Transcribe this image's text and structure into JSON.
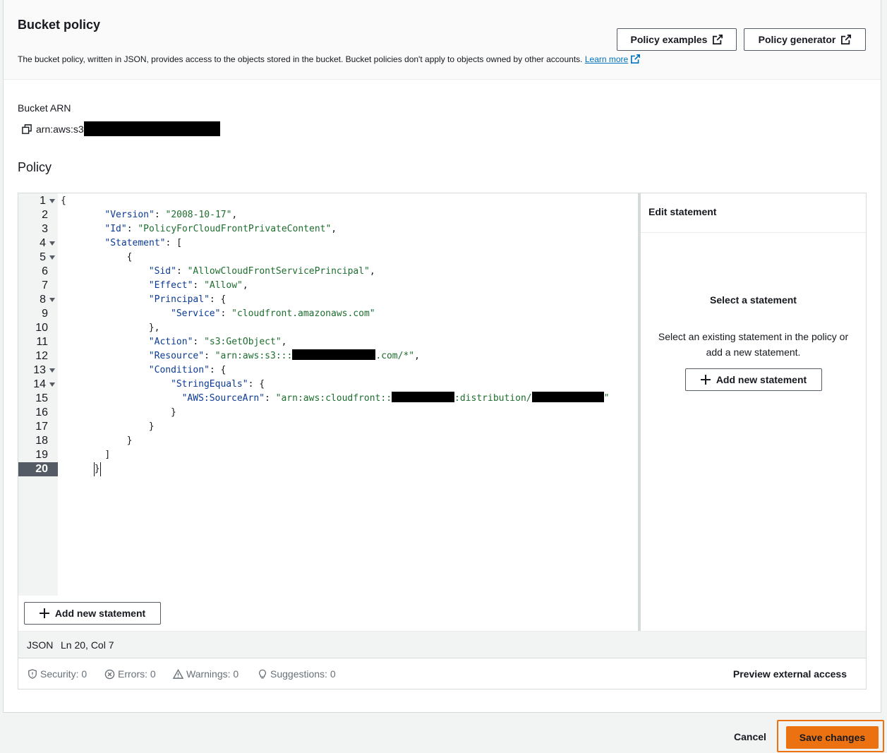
{
  "header": {
    "title": "Bucket policy",
    "description": "The bucket policy, written in JSON, provides access to the objects stored in the bucket. Bucket policies don't apply to objects owned by other accounts.",
    "learn_more": "Learn more",
    "policy_examples": "Policy examples",
    "policy_generator": "Policy generator"
  },
  "bucket_arn": {
    "label": "Bucket ARN",
    "value_prefix": "arn:aws:s3",
    "redacted": true
  },
  "policy": {
    "title": "Policy",
    "active_line": 20,
    "lines": [
      {
        "n": "1",
        "fold": true,
        "indent": 0,
        "tokens": [
          [
            "punc",
            "{"
          ]
        ]
      },
      {
        "n": "2",
        "fold": false,
        "indent": 8,
        "tokens": [
          [
            "key",
            "\"Version\""
          ],
          [
            "punc",
            ": "
          ],
          [
            "str",
            "\"2008-10-17\""
          ],
          [
            "punc",
            ","
          ]
        ]
      },
      {
        "n": "3",
        "fold": false,
        "indent": 8,
        "tokens": [
          [
            "key",
            "\"Id\""
          ],
          [
            "punc",
            ": "
          ],
          [
            "str",
            "\"PolicyForCloudFrontPrivateContent\""
          ],
          [
            "punc",
            ","
          ]
        ]
      },
      {
        "n": "4",
        "fold": true,
        "indent": 8,
        "tokens": [
          [
            "key",
            "\"Statement\""
          ],
          [
            "punc",
            ": ["
          ]
        ]
      },
      {
        "n": "5",
        "fold": true,
        "indent": 12,
        "tokens": [
          [
            "punc",
            "{"
          ]
        ]
      },
      {
        "n": "6",
        "fold": false,
        "indent": 16,
        "tokens": [
          [
            "key",
            "\"Sid\""
          ],
          [
            "punc",
            ": "
          ],
          [
            "str",
            "\"AllowCloudFrontServicePrincipal\""
          ],
          [
            "punc",
            ","
          ]
        ]
      },
      {
        "n": "7",
        "fold": false,
        "indent": 16,
        "tokens": [
          [
            "key",
            "\"Effect\""
          ],
          [
            "punc",
            ": "
          ],
          [
            "str",
            "\"Allow\""
          ],
          [
            "punc",
            ","
          ]
        ]
      },
      {
        "n": "8",
        "fold": true,
        "indent": 16,
        "tokens": [
          [
            "key",
            "\"Principal\""
          ],
          [
            "punc",
            ": {"
          ]
        ]
      },
      {
        "n": "9",
        "fold": false,
        "indent": 20,
        "tokens": [
          [
            "key",
            "\"Service\""
          ],
          [
            "punc",
            ": "
          ],
          [
            "str",
            "\"cloudfront.amazonaws.com\""
          ]
        ]
      },
      {
        "n": "10",
        "fold": false,
        "indent": 16,
        "tokens": [
          [
            "punc",
            "},"
          ]
        ]
      },
      {
        "n": "11",
        "fold": false,
        "indent": 16,
        "tokens": [
          [
            "key",
            "\"Action\""
          ],
          [
            "punc",
            ": "
          ],
          [
            "str",
            "\"s3:GetObject\""
          ],
          [
            "punc",
            ","
          ]
        ]
      },
      {
        "n": "12",
        "fold": false,
        "indent": 16,
        "tokens": [
          [
            "key",
            "\"Resource\""
          ],
          [
            "punc",
            ": "
          ],
          [
            "str",
            "\"arn:aws:s3:::"
          ],
          [
            "red",
            ""
          ],
          [
            "str",
            ".com/*\""
          ],
          [
            "punc",
            ","
          ]
        ]
      },
      {
        "n": "13",
        "fold": true,
        "indent": 16,
        "tokens": [
          [
            "key",
            "\"Condition\""
          ],
          [
            "punc",
            ": {"
          ]
        ]
      },
      {
        "n": "14",
        "fold": true,
        "indent": 20,
        "tokens": [
          [
            "key",
            "\"StringEquals\""
          ],
          [
            "punc",
            ": {"
          ]
        ]
      },
      {
        "n": "15",
        "fold": false,
        "indent": 22,
        "tokens": [
          [
            "key",
            "\"AWS:SourceArn\""
          ],
          [
            "punc",
            ": "
          ],
          [
            "str",
            "\"arn:aws:cloudfront::"
          ],
          [
            "red",
            ""
          ],
          [
            "str",
            ":distribution/"
          ],
          [
            "red",
            ""
          ],
          [
            "str",
            "\""
          ]
        ]
      },
      {
        "n": "16",
        "fold": false,
        "indent": 20,
        "tokens": [
          [
            "punc",
            "}"
          ]
        ]
      },
      {
        "n": "17",
        "fold": false,
        "indent": 16,
        "tokens": [
          [
            "punc",
            "}"
          ]
        ]
      },
      {
        "n": "18",
        "fold": false,
        "indent": 12,
        "tokens": [
          [
            "punc",
            "}"
          ]
        ]
      },
      {
        "n": "19",
        "fold": false,
        "indent": 8,
        "tokens": [
          [
            "punc",
            "]"
          ]
        ]
      },
      {
        "n": "20",
        "fold": false,
        "indent": 6,
        "tokens": [
          [
            "punc",
            "}"
          ]
        ]
      }
    ],
    "add_statement": "Add new statement"
  },
  "side_panel": {
    "title": "Edit statement",
    "select_title": "Select a statement",
    "select_desc": "Select an existing statement in the policy or add a new statement.",
    "add_statement": "Add new statement"
  },
  "status_bar": {
    "language": "JSON",
    "position": "Ln 20, Col 7"
  },
  "diagnostics": {
    "security": "Security: 0",
    "errors": "Errors: 0",
    "warnings": "Warnings: 0",
    "suggestions": "Suggestions: 0",
    "preview": "Preview external access"
  },
  "footer": {
    "cancel": "Cancel",
    "save": "Save changes"
  },
  "colors": {
    "accent": "#ec7211",
    "link": "#0073bb",
    "json_key": "#0b3a94",
    "json_string": "#1d6e2e"
  }
}
